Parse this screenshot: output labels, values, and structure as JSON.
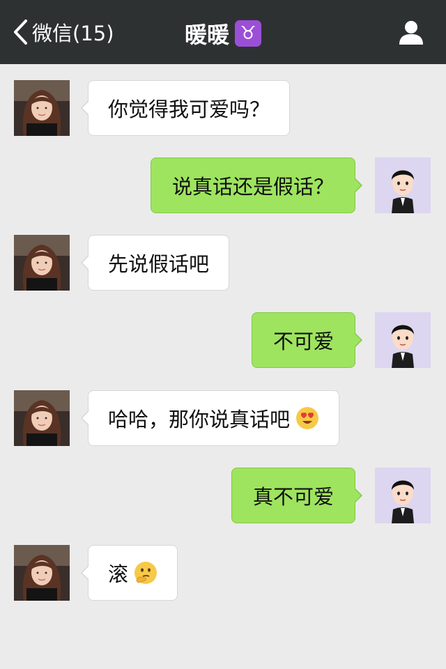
{
  "nav": {
    "back_label": "微信(15)",
    "title": "暖暖",
    "zodiac_symbol": "♉",
    "zodiac_color": "#9b4fd6"
  },
  "colors": {
    "nav_bg": "#2e3132",
    "chat_bg": "#ebebeb",
    "outgoing_bubble": "#9ee45f",
    "incoming_bubble": "#ffffff"
  },
  "messages": [
    {
      "from": "contact",
      "text": "你觉得我可爱吗？"
    },
    {
      "from": "me",
      "text": "说真话还是假话？"
    },
    {
      "from": "contact",
      "text": "先说假话吧"
    },
    {
      "from": "me",
      "text": "不可爱"
    },
    {
      "from": "contact",
      "text": "哈哈，那你说真话吧",
      "emoji": "heart-eyes-emoji"
    },
    {
      "from": "me",
      "text": "真不可爱"
    },
    {
      "from": "contact",
      "text": "滚",
      "emoji": "thinking-emoji"
    }
  ]
}
